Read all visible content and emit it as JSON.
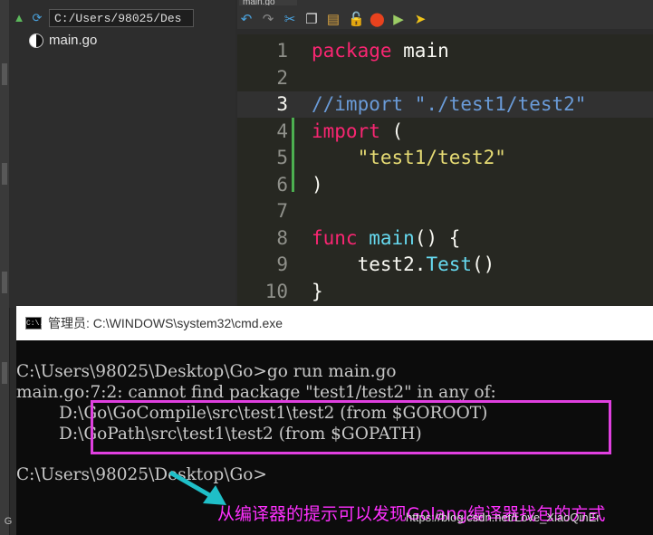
{
  "file_panel": {
    "path": "C:/Users/98025/Des",
    "files": [
      {
        "name": "main.go",
        "icon": "gopher-yinyang-icon"
      }
    ],
    "toolbar_icons": [
      "up-arrow-icon",
      "refresh-icon"
    ]
  },
  "editor": {
    "tab_label": "main.go",
    "toolbar_icons": [
      "undo-icon",
      "redo-icon",
      "cut-icon",
      "copy-icon",
      "paste-icon",
      "lock-icon",
      "record-icon",
      "run-icon",
      "build-icon"
    ],
    "lines": [
      {
        "n": "1",
        "tokens": [
          {
            "t": "package",
            "c": "kw"
          },
          {
            "t": " main",
            "c": ""
          }
        ]
      },
      {
        "n": "2",
        "tokens": []
      },
      {
        "n": "3",
        "tokens": [
          {
            "t": "//import \"./test1/test2\"",
            "c": "cmt-blue"
          }
        ],
        "current": true
      },
      {
        "n": "4",
        "tokens": [
          {
            "t": "import",
            "c": "kw"
          },
          {
            "t": " (",
            "c": ""
          }
        ]
      },
      {
        "n": "5",
        "tokens": [
          {
            "t": "    ",
            "c": ""
          },
          {
            "t": "\"test1/test2\"",
            "c": "str"
          }
        ]
      },
      {
        "n": "6",
        "tokens": [
          {
            "t": ")",
            "c": ""
          }
        ]
      },
      {
        "n": "7",
        "tokens": []
      },
      {
        "n": "8",
        "tokens": [
          {
            "t": "func",
            "c": "kw"
          },
          {
            "t": " ",
            "c": ""
          },
          {
            "t": "main",
            "c": "fn"
          },
          {
            "t": "() {",
            "c": ""
          }
        ]
      },
      {
        "n": "9",
        "tokens": [
          {
            "t": "    test2.",
            "c": ""
          },
          {
            "t": "Test",
            "c": "fn"
          },
          {
            "t": "()",
            "c": ""
          }
        ]
      },
      {
        "n": "10",
        "tokens": [
          {
            "t": "}",
            "c": ""
          }
        ]
      }
    ]
  },
  "cmd": {
    "title": "管理员: C:\\WINDOWS\\system32\\cmd.exe",
    "icon_text": "C:\\.",
    "lines": [
      "C:\\Users\\98025\\Desktop\\Go>go run main.go",
      "main.go:7:2: cannot find package \"test1/test2\" in any of:",
      "        D:\\Go\\GoCompile\\src\\test1\\test2 (from $GOROOT)",
      "        D:\\GoPath\\src\\test1\\test2 (from $GOPATH)",
      "",
      "C:\\Users\\98025\\Desktop\\Go>"
    ]
  },
  "annotation": {
    "text": "从编译器的提示可以发现Golang编译器找包的方式",
    "color": "#ff30ff",
    "arrow_color": "#1fbfc8"
  },
  "watermark": "https://blog.csdn.net/Love_XiaoQinEr",
  "left_bottom_char": "G"
}
